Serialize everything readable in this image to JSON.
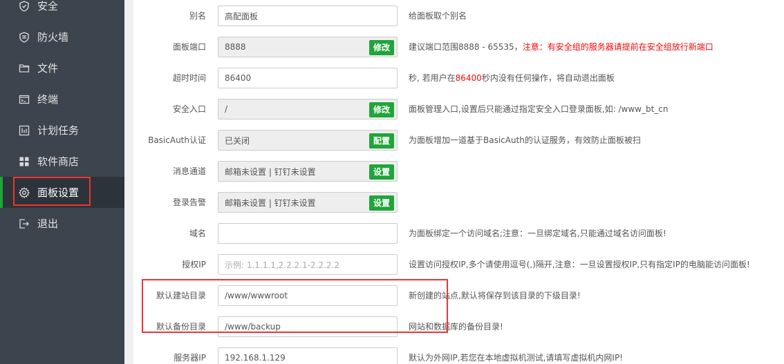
{
  "sidebar": {
    "items": [
      {
        "label": "安全",
        "icon": "shield-icon"
      },
      {
        "label": "防火墙",
        "icon": "firewall-icon"
      },
      {
        "label": "文件",
        "icon": "folder-icon"
      },
      {
        "label": "终端",
        "icon": "terminal-icon"
      },
      {
        "label": "计划任务",
        "icon": "schedule-icon"
      },
      {
        "label": "软件商店",
        "icon": "store-icon"
      },
      {
        "label": "面板设置",
        "icon": "gear-icon",
        "active": true
      },
      {
        "label": "退出",
        "icon": "logout-icon"
      }
    ]
  },
  "form": {
    "alias": {
      "label": "别名",
      "value": "高配面板",
      "hint": "给面板取个别名"
    },
    "port": {
      "label": "面板端口",
      "value": "8888",
      "button": "修改",
      "hint_a": "建议端口范围8888 - 65535，",
      "hint_b": "注意：有安全组的服务器请提前在安全组放行新端口"
    },
    "timeout": {
      "label": "超时时间",
      "value": "86400",
      "hint_a": "秒, 若用户在",
      "hint_b": "86400",
      "hint_c": "秒内没有任何操作，将自动退出面板"
    },
    "entry": {
      "label": "安全入口",
      "value": "/",
      "button": "修改",
      "hint": "面板管理入口,设置后只能通过指定安全入口登录面板,如: /www_bt_cn"
    },
    "basicauth": {
      "label": "BasicAuth认证",
      "value": "已关闭",
      "button": "配置",
      "hint": "为面板增加一道基于BasicAuth的认证服务，有效防止面板被扫"
    },
    "msg": {
      "label": "消息通道",
      "value": "邮箱未设置 | 钉钉未设置",
      "button": "设置"
    },
    "login_alert": {
      "label": "登录告警",
      "value": "邮箱未设置 | 钉钉未设置",
      "button": "设置"
    },
    "domain": {
      "label": "域名",
      "value": "",
      "hint": "为面板绑定一个访问域名;注意：一旦绑定域名,只能通过域名访问面板!"
    },
    "auth_ip": {
      "label": "授权IP",
      "placeholder": "示例: 1.1.1.1,2.2.2.1-2.2.2.2",
      "hint": "设置访问授权IP,多个请使用逗号(,)隔开,注意：一旦设置授权IP,只有指定IP的电脑能访问面板!"
    },
    "site_dir": {
      "label": "默认建站目录",
      "value": "/www/wwwroot",
      "hint": "新创建的站点,默认将保存到该目录的下级目录!"
    },
    "backup_dir": {
      "label": "默认备份目录",
      "value": "/www/backup",
      "hint": "网站和数据库的备份目录!"
    },
    "server_ip": {
      "label": "服务器IP",
      "value": "192.168.1.129",
      "hint": "默认为外网IP,若您在本地虚拟机测试,请填写虚拟机内网IP!"
    }
  },
  "colors": {
    "accent": "#20a53a",
    "sidebar_bg": "#3c444d",
    "highlight": "#e33333",
    "warning": "#ef0808"
  }
}
